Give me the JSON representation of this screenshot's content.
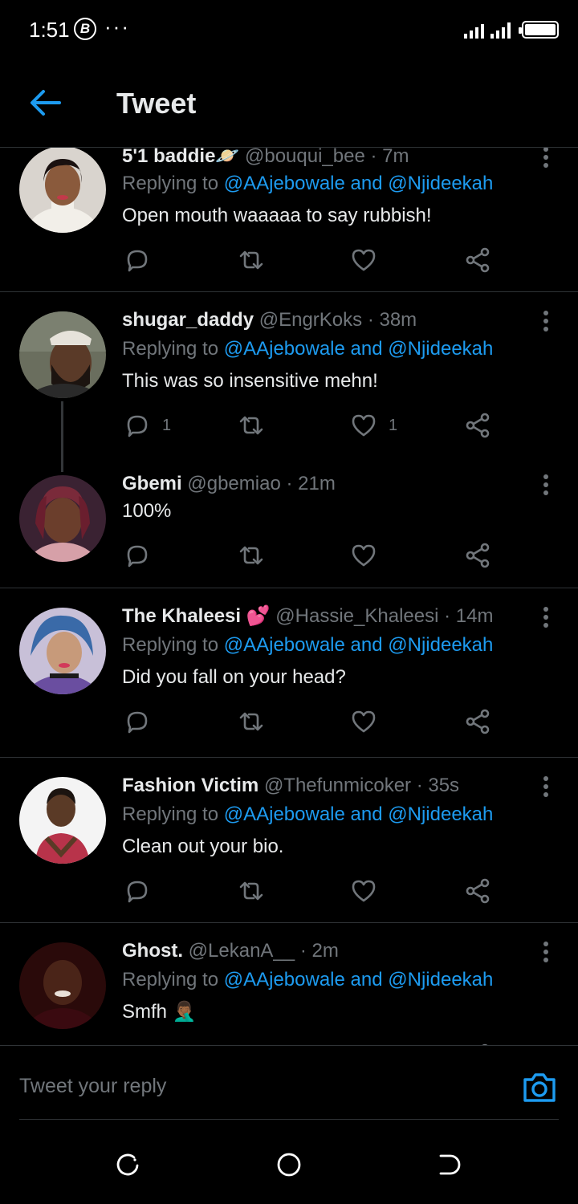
{
  "status_bar": {
    "time": "1:51",
    "badge_letter": "B",
    "dots": "···"
  },
  "header": {
    "title": "Tweet"
  },
  "tweets": [
    {
      "display_name": "5'1 baddie",
      "name_suffix": "🪐",
      "handle": "@bouqui_bee",
      "time": "· 7m",
      "replying_prefix": "Replying to",
      "mention_1": "@AAjebowale",
      "mention_and": "and",
      "mention_2": "@Njideekah",
      "text": "Open mouth waaaaa to say rubbish!",
      "reply_count": "",
      "like_count": ""
    },
    {
      "display_name": "shugar_daddy",
      "handle": "@EngrKoks",
      "time": "· 38m",
      "replying_prefix": "Replying to",
      "mention_1": "@AAjebowale",
      "mention_and": "and",
      "mention_2": "@Njideekah",
      "text": "This was so insensitive mehn!",
      "reply_count": "1",
      "like_count": "1"
    },
    {
      "display_name": "Gbemi",
      "handle": "@gbemiao",
      "time": "· 21m",
      "text": "100%",
      "reply_count": "",
      "like_count": ""
    },
    {
      "display_name": "The Khaleesi",
      "name_emoji": "💕",
      "handle": "@Hassie_Khaleesi",
      "time": "· 14m",
      "replying_prefix": "Replying to",
      "mention_1": "@AAjebowale",
      "mention_and": "and",
      "mention_2": "@Njideekah",
      "text": "Did you fall on your head?",
      "reply_count": "",
      "like_count": ""
    },
    {
      "display_name": "Fashion Victim",
      "handle": "@Thefunmicoker",
      "time": "· 35s",
      "replying_prefix": "Replying to",
      "mention_1": "@AAjebowale",
      "mention_and": "and",
      "mention_2": "@Njideekah",
      "text": "Clean out your bio.",
      "reply_count": "",
      "like_count": ""
    },
    {
      "display_name": "Ghost.",
      "handle": "@LekanA__",
      "time": "· 2m",
      "replying_prefix": "Replying to",
      "mention_1": "@AAjebowale",
      "mention_and": "and",
      "mention_2": "@Njideekah",
      "text": "Smfh",
      "text_emoji": "🤦🏾‍♂️",
      "reply_count": "",
      "like_count": ""
    }
  ],
  "reply_bar": {
    "placeholder": "Tweet your reply"
  },
  "colors": {
    "accent": "#1d9bf0",
    "muted": "#71767b",
    "background": "#000000",
    "divider": "#2f3336"
  },
  "icons": {
    "back": "back-arrow-icon",
    "more": "more-vertical-icon",
    "reply": "reply-icon",
    "retweet": "retweet-icon",
    "like": "heart-icon",
    "share": "share-icon",
    "camera": "camera-icon"
  }
}
